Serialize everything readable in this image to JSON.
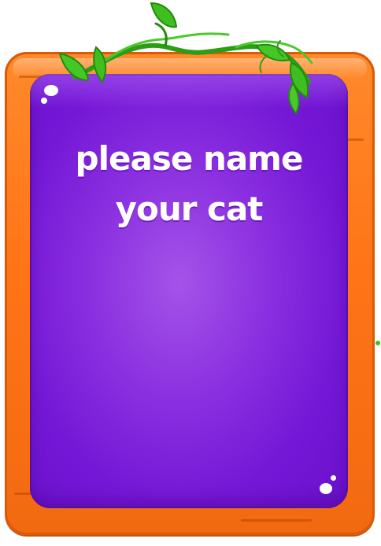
{
  "sign": {
    "title": "please name your cat"
  },
  "colors": {
    "frame_orange": "#ff7a1f",
    "panel_purple": "#7a1bd8",
    "vine_green": "#3dbb1e",
    "text_white": "#ffffff"
  },
  "decorations": {
    "vine_icon": "vine-icon",
    "leaf_icon": "leaf-icon"
  }
}
